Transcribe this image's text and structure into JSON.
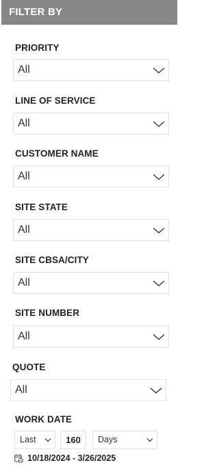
{
  "header": {
    "title": "FILTER BY"
  },
  "filters": [
    {
      "label": "PRIORITY",
      "value": "All"
    },
    {
      "label": "LINE OF SERVICE",
      "value": "All"
    },
    {
      "label": "CUSTOMER NAME",
      "value": "All"
    },
    {
      "label": "SITE STATE",
      "value": "All"
    },
    {
      "label": "SITE CBSA/CITY",
      "value": "All"
    },
    {
      "label": "SITE NUMBER",
      "value": "All"
    },
    {
      "label": "QUOTE",
      "value": "All"
    }
  ],
  "work_date": {
    "label": "WORK DATE",
    "period": "Last",
    "amount": "160",
    "unit": "Days",
    "range": "10/18/2024 - 3/26/2025"
  },
  "icons": {
    "dropdown": "chevron-down-icon",
    "calendar": "calendar-clock-icon"
  },
  "colors": {
    "header_bg": "#878787",
    "border": "#e1e1e1"
  }
}
